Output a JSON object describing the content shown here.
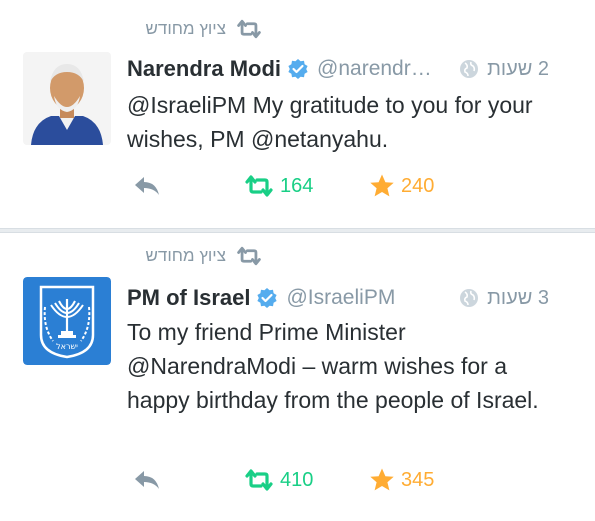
{
  "tweets": [
    {
      "retweeted_label": "ציוץ מחודש",
      "name": "Narendra Modi",
      "handle": "@narendr…",
      "time": "2 שעות",
      "text": "@IsraeliPM My gratitude to you for your wishes, PM @netanyahu.",
      "retweets": "164",
      "favorites": "240",
      "verified": true,
      "avatar": "person-photo"
    },
    {
      "retweeted_label": "ציוץ מחודש",
      "name": "PM of Israel",
      "handle": "@IsraeliPM",
      "time": "3 שעות",
      "text": "To my friend Prime Minister @NarendraModi – warm wishes for a happy birthday from the people of Israel.",
      "retweets": "410",
      "favorites": "345",
      "verified": true,
      "avatar": "emblem-of-israel",
      "avatar_text": "ישראל"
    }
  ],
  "colors": {
    "retweet": "#19cf86",
    "favorite": "#ffac33",
    "secondary": "#8899a6",
    "verified": "#55acee",
    "emblem_bg": "#2b7fd4"
  }
}
